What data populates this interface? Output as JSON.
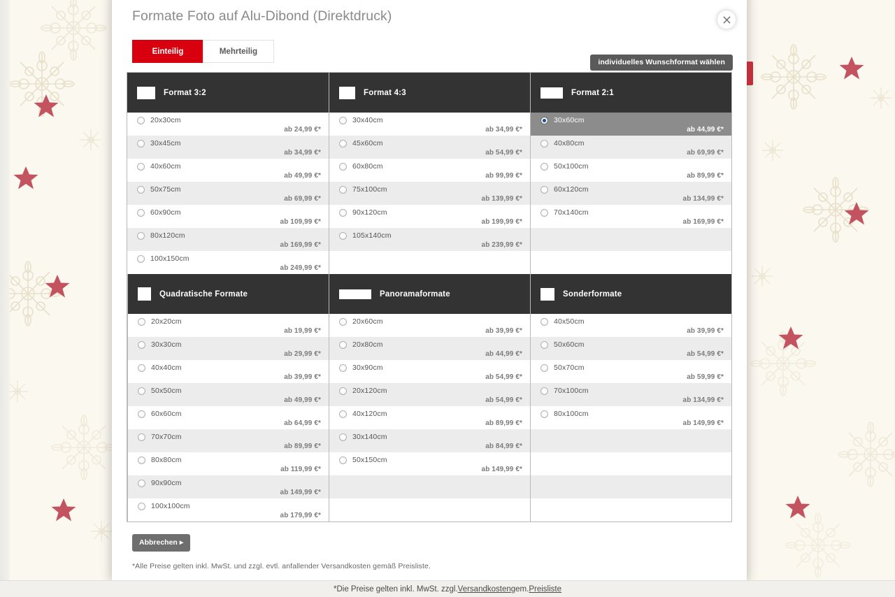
{
  "modal": {
    "title": "Formate Foto auf Alu-Dibond (Direktdruck)",
    "close_icon": "close-icon",
    "tabs": [
      {
        "label": "Einteilig",
        "active": true
      },
      {
        "label": "Mehrteilig",
        "active": false
      }
    ],
    "wish_format_label": "individuelles Wunschformat wählen",
    "cancel_label": "Abbrechen",
    "cancel_arrow": "▸",
    "legal_note": "*Alle Preise gelten inkl. MwSt. und zzgl. evtl. anfallender Versandkosten gemäß Preisliste."
  },
  "colors": {
    "accent_red": "#d8000f",
    "panel_head": "#333333",
    "row_alt": "#ececec",
    "row_selected": "#8c8c8c",
    "radio_dot": "#15538f"
  },
  "panels": [
    {
      "title": "Format 3:2",
      "thumb": "r32",
      "items": [
        {
          "size": "20x30cm",
          "price": "ab 24,99 €*"
        },
        {
          "size": "30x45cm",
          "price": "ab 34,99 €*"
        },
        {
          "size": "40x60cm",
          "price": "ab 49,99 €*"
        },
        {
          "size": "50x75cm",
          "price": "ab 69,99 €*"
        },
        {
          "size": "60x90cm",
          "price": "ab 109,99 €*"
        },
        {
          "size": "80x120cm",
          "price": "ab 169,99 €*"
        },
        {
          "size": "100x150cm",
          "price": "ab 249,99 €*"
        }
      ]
    },
    {
      "title": "Format 4:3",
      "thumb": "r43",
      "items": [
        {
          "size": "30x40cm",
          "price": "ab 34,99 €*"
        },
        {
          "size": "45x60cm",
          "price": "ab 54,99 €*"
        },
        {
          "size": "60x80cm",
          "price": "ab 99,99 €*"
        },
        {
          "size": "75x100cm",
          "price": "ab 139,99 €*"
        },
        {
          "size": "90x120cm",
          "price": "ab 199,99 €*"
        },
        {
          "size": "105x140cm",
          "price": "ab 239,99 €*"
        }
      ]
    },
    {
      "title": "Format 2:1",
      "thumb": "r21",
      "items": [
        {
          "size": "30x60cm",
          "price": "ab 44,99 €*",
          "selected": true
        },
        {
          "size": "40x80cm",
          "price": "ab 69,99 €*"
        },
        {
          "size": "50x100cm",
          "price": "ab 89,99 €*"
        },
        {
          "size": "60x120cm",
          "price": "ab 134,99 €*"
        },
        {
          "size": "70x140cm",
          "price": "ab 169,99 €*"
        }
      ]
    },
    {
      "title": "Quadratische Formate",
      "thumb": "sq",
      "items": [
        {
          "size": "20x20cm",
          "price": "ab 19,99 €*"
        },
        {
          "size": "30x30cm",
          "price": "ab 29,99 €*"
        },
        {
          "size": "40x40cm",
          "price": "ab 39,99 €*"
        },
        {
          "size": "50x50cm",
          "price": "ab 49,99 €*"
        },
        {
          "size": "60x60cm",
          "price": "ab 64,99 €*"
        },
        {
          "size": "70x70cm",
          "price": "ab 89,99 €*"
        },
        {
          "size": "80x80cm",
          "price": "ab 119,99 €*"
        },
        {
          "size": "90x90cm",
          "price": "ab 149,99 €*"
        },
        {
          "size": "100x100cm",
          "price": "ab 179,99 €*"
        }
      ]
    },
    {
      "title": "Panoramaformate",
      "thumb": "pano",
      "items": [
        {
          "size": "20x60cm",
          "price": "ab 39,99 €*"
        },
        {
          "size": "20x80cm",
          "price": "ab 44,99 €*"
        },
        {
          "size": "30x90cm",
          "price": "ab 54,99 €*"
        },
        {
          "size": "20x120cm",
          "price": "ab 54,99 €*"
        },
        {
          "size": "40x120cm",
          "price": "ab 89,99 €*"
        },
        {
          "size": "30x140cm",
          "price": "ab 84,99 €*"
        },
        {
          "size": "50x150cm",
          "price": "ab 149,99 €*"
        }
      ]
    },
    {
      "title": "Sonderformate",
      "thumb": "sond",
      "items": [
        {
          "size": "40x50cm",
          "price": "ab 39,99 €*"
        },
        {
          "size": "50x60cm",
          "price": "ab 54,99 €*"
        },
        {
          "size": "50x70cm",
          "price": "ab 59,99 €*"
        },
        {
          "size": "70x100cm",
          "price": "ab 134,99 €*"
        },
        {
          "size": "80x100cm",
          "price": "ab 149,99 €*"
        }
      ]
    }
  ],
  "page_footer": {
    "prefix": "*Die Preise gelten inkl. MwSt. zzgl. ",
    "link1": "Versandkosten",
    "middle": " gem. ",
    "link2": "Preisliste"
  }
}
